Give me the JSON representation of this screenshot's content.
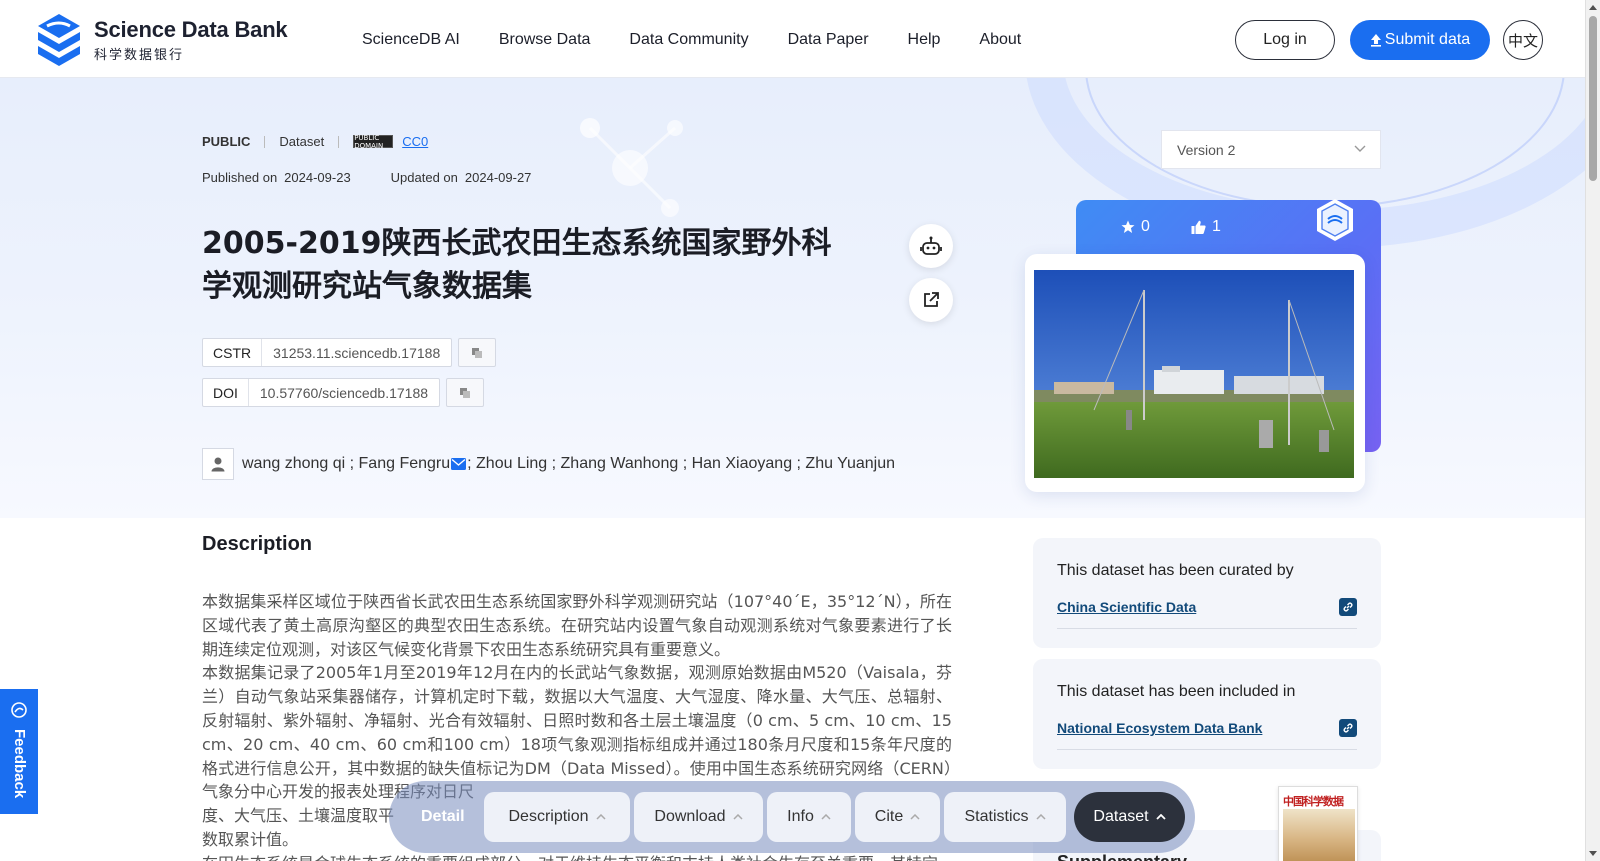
{
  "header": {
    "logo_en": "Science Data Bank",
    "logo_cn": "科学数据银行",
    "nav": [
      "ScienceDB AI",
      "Browse Data",
      "Data Community",
      "Data Paper",
      "Help",
      "About"
    ],
    "login": "Log in",
    "submit": "Submit data",
    "lang": "中文"
  },
  "meta": {
    "visibility": "PUBLIC",
    "type": "Dataset",
    "license_badge": "PUBLIC DOMAIN",
    "license": "CC0",
    "published_label": "Published on",
    "published_date": "2024-09-23",
    "updated_label": "Updated on",
    "updated_date": "2024-09-27"
  },
  "title": "2005-2019陕西长武农田生态系统国家野外科学观测研究站气象数据集",
  "ids": {
    "cstr_key": "CSTR",
    "cstr_val": "31253.11.sciencedb.17188",
    "doi_key": "DOI",
    "doi_val": "10.57760/sciencedb.17188"
  },
  "authors": {
    "part1": "wang zhong qi ; Fang Fengru",
    "part2": "; Zhou Ling ; Zhang Wanhong ; Han Xiaoyang ; Zhu Yuanjun"
  },
  "description": {
    "heading": "Description",
    "p1": "本数据集采样区域位于陕西省长武农田生态系统国家野外科学观测研究站（107°40´E，35°12´N），所在区域代表了黄土高原沟壑区的典型农田生态系统。在研究站内设置气象自动观测系统对气象要素进行了长期连续定位观测，对该区气候变化背景下农田生态系统研究具有重要意义。",
    "p2": "本数据集记录了2005年1月至2019年12月在内的长武站气象数据，观测原始数据由M520（Vaisala，芬兰）自动气象站采集器储存，计算机定时下载，数据以大气温度、大气湿度、降水量、大气压、总辐射、反射辐射、紫外辐射、净辐射、光合有效辐射、日照时数和各土层土壤温度（0 cm、5 cm、10 cm、15 cm、20 cm、40 cm、60 cm和100 cm）18项气象观测指标组成并通过180条月尺度和15条年尺度的格式进行信息公开，其中数据的缺失值标记为DM（Data Missed）。使用中国生态系统研究网络（CERN）气象分中心开发的报表处理程序对日尺",
    "p3": "度、大气压、土壤温度取平",
    "p4": "数取累计值。",
    "p5": "在田生态系统是会球生态系统的重要组成部分，对于维持生态平衡和支持人类社会生存至关重要，其特定"
  },
  "sidebar": {
    "version": "Version 2",
    "stars": "0",
    "likes": "1",
    "curated_label": "This dataset has been curated by",
    "curated_link": "China Scientific Data",
    "included_label": "This dataset has been included in",
    "included_link": "National Ecosystem Data Bank",
    "supplementary": "Supplementary",
    "journal_title": "中国科学数据"
  },
  "feedback": "Feedback",
  "tabs": {
    "detail": "Detail",
    "items": [
      "Description",
      "Download",
      "Info",
      "Cite",
      "Statistics",
      "Dataset"
    ]
  },
  "colors": {
    "brand_blue": "#1a6ef0",
    "link_dark": "#124a7a",
    "tab_active": "#2c313c"
  }
}
